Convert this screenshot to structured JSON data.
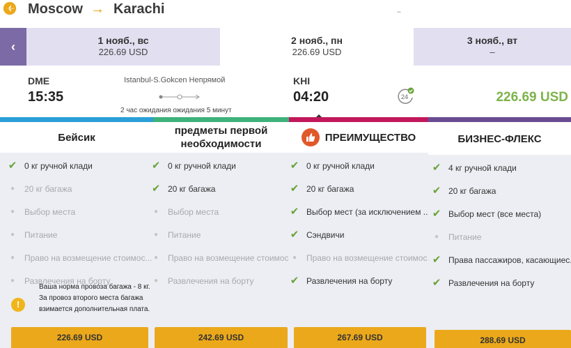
{
  "route": {
    "from": "Moscow",
    "arrow": "→",
    "to": "Karachi"
  },
  "dates": {
    "prev_label": "‹",
    "tabs": [
      {
        "date": "1 нояб., вс",
        "price": "226.69 USD"
      },
      {
        "date": "2 нояб., пн",
        "price": "226.69 USD"
      },
      {
        "date": "3 нояб., вт",
        "price": "–"
      }
    ]
  },
  "flight": {
    "dep_code": "DME",
    "dep_time": "15:35",
    "via": "Istanbul-S.Gokcen Непрямой",
    "wait": "2 час ожидания ожидания 5 минут",
    "arr_code": "KHI",
    "arr_time": "04:20",
    "badge": "24",
    "price": "226.69 USD"
  },
  "colors": {
    "accent": "#eba81a",
    "price_green": "#7db34a",
    "tab_purple": "#7b6aa5",
    "check": "#6aa23a"
  },
  "fares": [
    {
      "name": "Бейсик",
      "features": [
        {
          "text": "0 кг ручной клади",
          "on": true
        },
        {
          "text": "20 кг багажа",
          "on": false
        },
        {
          "text": "Выбор места",
          "on": false
        },
        {
          "text": "Питание",
          "on": false
        },
        {
          "text": "Право на возмещение стоимос...",
          "on": false
        },
        {
          "text": "Развлечения на борту",
          "on": false
        }
      ],
      "note": "Ваша норма провоза багажа - 8 кг. За провоз второго места багажа взимается дополнительная плата.",
      "price": "226.69 USD"
    },
    {
      "name": "предметы первой необходимости",
      "features": [
        {
          "text": "0 кг ручной клади",
          "on": true
        },
        {
          "text": "20 кг багажа",
          "on": true
        },
        {
          "text": "Выбор места",
          "on": false
        },
        {
          "text": "Питание",
          "on": false
        },
        {
          "text": "Право на возмещение стоимос...",
          "on": false
        },
        {
          "text": "Развлечения на борту",
          "on": false
        }
      ],
      "price": "242.69 USD"
    },
    {
      "name": "ПРЕИМУЩЕСТВО",
      "features": [
        {
          "text": "0 кг ручной клади",
          "on": true
        },
        {
          "text": "20 кг багажа",
          "on": true
        },
        {
          "text": "Выбор мест (за исключением ...",
          "on": true
        },
        {
          "text": "Сэндвичи",
          "on": true
        },
        {
          "text": "Право на возмещение стоимос...",
          "on": false
        },
        {
          "text": "Развлечения на борту",
          "on": true
        }
      ],
      "price": "267.69 USD"
    },
    {
      "name": "БИЗНЕС-ФЛЕКС",
      "features": [
        {
          "text": "4 кг ручной клади",
          "on": true
        },
        {
          "text": "20 кг багажа",
          "on": true
        },
        {
          "text": "Выбор мест (все места)",
          "on": true
        },
        {
          "text": "Питание",
          "on": false
        },
        {
          "text": "Права пассажиров, касающиес...",
          "on": true
        },
        {
          "text": "Развлечения на борту",
          "on": true
        }
      ],
      "price": "288.69 USD"
    }
  ]
}
